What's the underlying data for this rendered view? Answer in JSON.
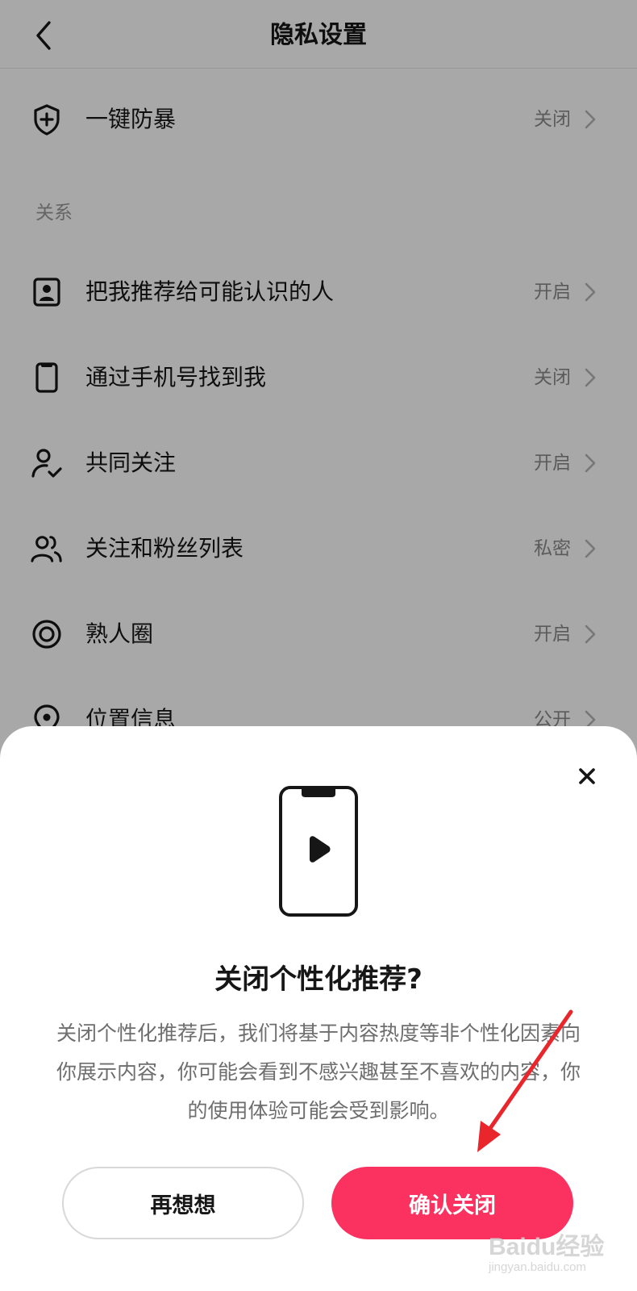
{
  "header": {
    "title": "隐私设置",
    "back_icon": "chevron-left-icon"
  },
  "top_item": {
    "label": "一键防暴",
    "value": "关闭",
    "icon": "shield-plus-icon"
  },
  "section": {
    "title": "关系"
  },
  "items": [
    {
      "label": "把我推荐给可能认识的人",
      "value": "开启",
      "icon": "contact-card-icon"
    },
    {
      "label": "通过手机号找到我",
      "value": "关闭",
      "icon": "phone-icon"
    },
    {
      "label": "共同关注",
      "value": "开启",
      "icon": "user-check-icon"
    },
    {
      "label": "关注和粉丝列表",
      "value": "私密",
      "icon": "users-icon"
    },
    {
      "label": "熟人圈",
      "value": "开启",
      "icon": "circle-target-icon"
    },
    {
      "label": "位置信息",
      "value": "公开",
      "icon": "location-pin-icon"
    }
  ],
  "dialog": {
    "title": "关闭个性化推荐?",
    "description": "关闭个性化推荐后，我们将基于内容热度等非个性化因素向你展示内容，你可能会看到不感兴趣甚至不喜欢的内容，你的使用体验可能会受到影响。",
    "cancel_label": "再想想",
    "confirm_label": "确认关闭",
    "close_icon": "close-icon",
    "illustration_icon": "phone-play-icon"
  },
  "colors": {
    "accent": "#fb3160",
    "annotation_arrow": "#e8262b"
  },
  "watermark": {
    "brand": "Baidu经验",
    "url": "jingyan.baidu.com"
  }
}
